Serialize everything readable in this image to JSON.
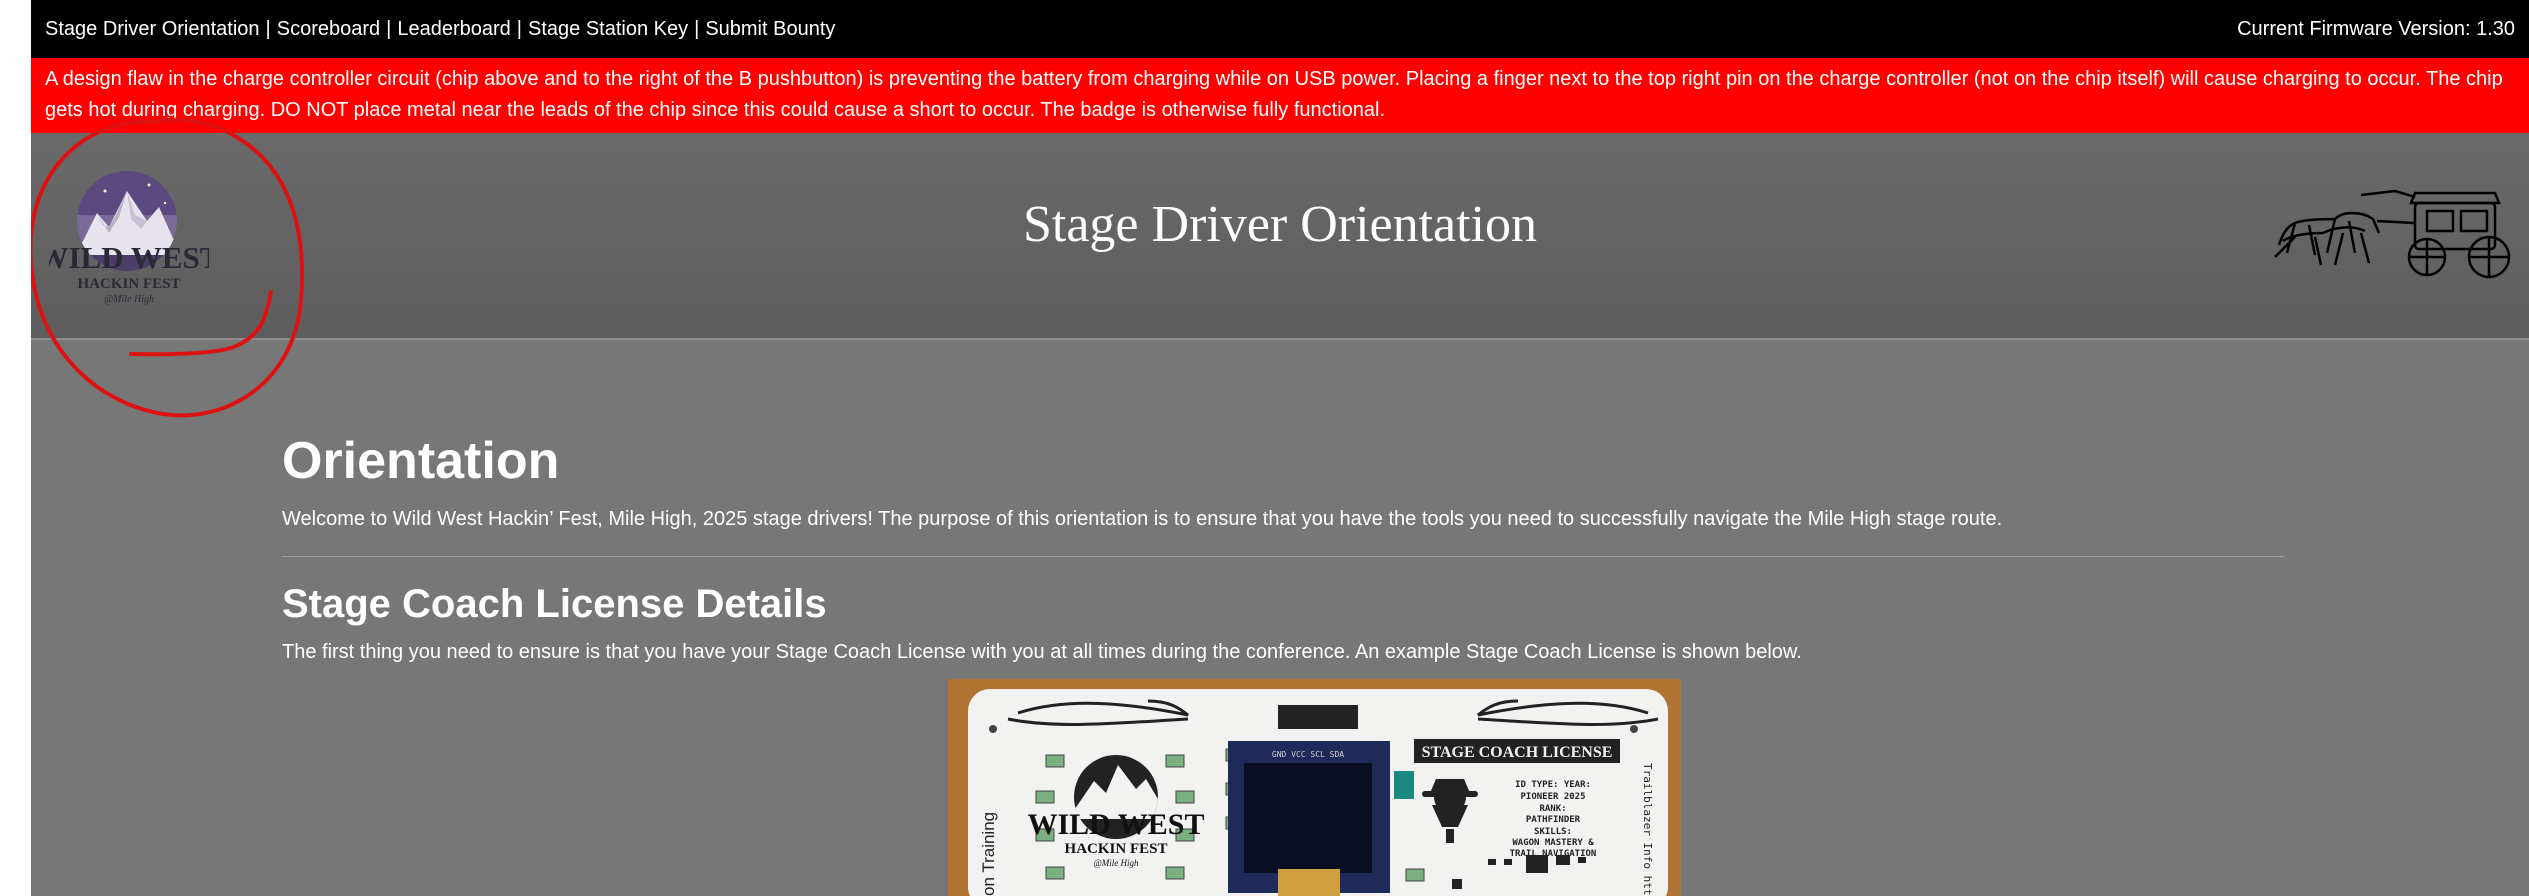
{
  "nav": {
    "links": [
      "Stage Driver Orientation",
      "Scoreboard",
      "Leaderboard",
      "Stage Station Key",
      "Submit Bounty"
    ],
    "separator": "|",
    "firmware": "Current Firmware Version: 1.30"
  },
  "alert": {
    "text": "A design flaw in the charge controller circuit (chip above and to the right of the B pushbutton) is preventing the battery from charging while on USB power. Placing a finger next to the top right pin on the charge controller (not on the chip itself) will cause charging to occur. The chip gets hot during charging. DO NOT place metal near the leads of the chip since this could cause a short to occur. The badge is otherwise fully functional."
  },
  "banner": {
    "title": "Stage Driver Orientation",
    "logo": {
      "line1": "WILD WEST",
      "line2": "HACKIN FEST",
      "line3": "@Mile High"
    }
  },
  "content": {
    "heading": "Orientation",
    "welcome": "Welcome to Wild West Hackin’ Fest, Mile High, 2025 stage drivers! The purpose of this orientation is to ensure that you have the tools you need to successfully navigate the Mile High stage route.",
    "license_heading": "Stage Coach License Details",
    "license_text": "The first thing you need to ensure is that you have your Stage Coach License with you at all times during the conference. An example Stage Coach License is shown below."
  },
  "badge": {
    "title": "STAGE COACH LICENSE",
    "logo_line1": "WILD WEST",
    "logo_line2": "HACKIN FEST",
    "logo_line3": "@Mile High",
    "pins": "GND VCC SCL SDA",
    "side_left": "on Training",
    "side_right": "Trailblazer Info https",
    "info_lines": [
      "ID TYPE:  YEAR:",
      "PIONEER  2025",
      "RANK:",
      "PATHFINDER",
      "SKILLS:",
      "WAGON MASTERY &",
      "TRAIL NAVIGATION"
    ]
  },
  "colors": {
    "nav_bg": "#000000",
    "alert_bg": "#ff0000",
    "page_bg": "#777777",
    "annotation": "#dd1111"
  }
}
